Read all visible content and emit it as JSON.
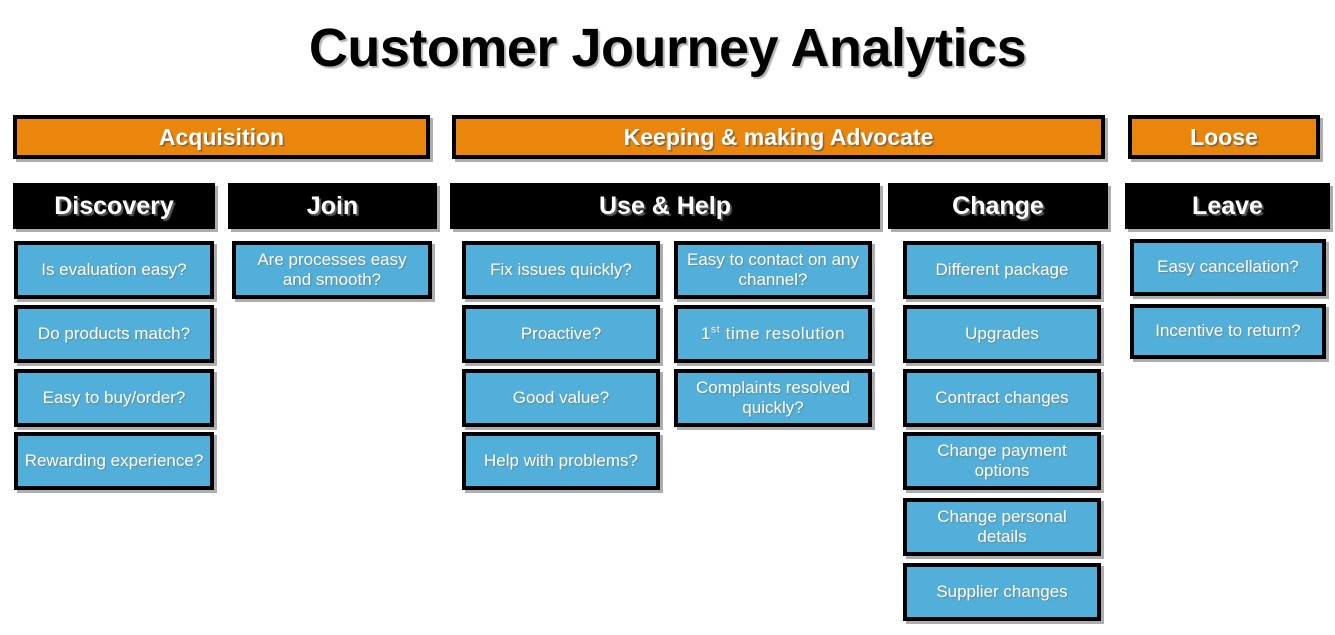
{
  "title": "Customer Journey Analytics",
  "colors": {
    "phase_bar": "#E9860B",
    "stage_header": "#000000",
    "metric_box": "#51AFD9",
    "text_light": "#FFFFFF",
    "background": "#FFFFFF"
  },
  "phases": [
    {
      "id": "acquisition",
      "label": "Acquisition"
    },
    {
      "id": "keeping",
      "label": "Keeping & making Advocate"
    },
    {
      "id": "loose",
      "label": "Loose"
    }
  ],
  "stages": [
    {
      "id": "discovery",
      "label": "Discovery"
    },
    {
      "id": "join",
      "label": "Join"
    },
    {
      "id": "use-help",
      "label": "Use & Help"
    },
    {
      "id": "change",
      "label": "Change"
    },
    {
      "id": "leave",
      "label": "Leave"
    }
  ],
  "metrics": {
    "discovery": [
      "Is evaluation easy?",
      "Do products match?",
      "Easy to buy/order?",
      "Rewarding experience?"
    ],
    "join": [
      "Are processes easy and smooth?"
    ],
    "use_help_left": [
      "Fix issues quickly?",
      "Proactive?",
      "Good value?",
      "Help with problems?"
    ],
    "use_help_right": [
      "Easy to contact on any channel?",
      "1st time resolution",
      "Complaints resolved quickly?"
    ],
    "change": [
      "Different package",
      "Upgrades",
      "Contract changes",
      "Change payment options",
      "Change personal details",
      "Supplier changes"
    ],
    "leave": [
      "Easy cancellation?",
      "Incentive to return?"
    ]
  },
  "ordinal": {
    "number": "1",
    "suffix": "st",
    "rest": " time resolution"
  }
}
